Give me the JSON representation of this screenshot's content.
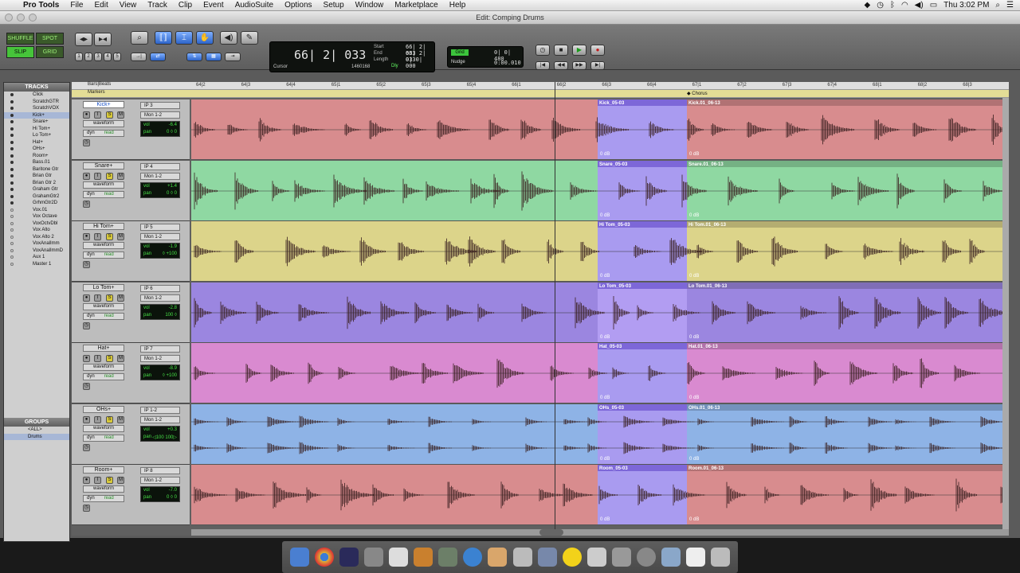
{
  "menubar": {
    "items": [
      "Pro Tools",
      "File",
      "Edit",
      "View",
      "Track",
      "Clip",
      "Event",
      "AudioSuite",
      "Options",
      "Setup",
      "Window",
      "Marketplace",
      "Help"
    ],
    "clock": "Thu 3:02 PM"
  },
  "window": {
    "title": "Edit: Comping Drums"
  },
  "toolbar": {
    "modes": [
      "SHUFFLE",
      "SPOT",
      "SLIP",
      "GRID"
    ],
    "edit_mode_active": "SLIP",
    "zoom_presets": [
      "1",
      "2",
      "3",
      "4",
      "5"
    ],
    "counter_main": "66| 2| 033",
    "start_label": "Start",
    "start_value": "66| 2| 033",
    "end_label": "End",
    "end_value": "66| 2| 033",
    "length_label": "Length",
    "length_value": "0| 0| 000",
    "cursor_label": "Cursor",
    "cursor_value": "1460168",
    "dly_label": "Dly",
    "grid_label": "Grid",
    "grid_value": "0| 0| 480",
    "nudge_label": "Nudge",
    "nudge_value": "0:00.010"
  },
  "tracks_panel": {
    "title": "TRACKS",
    "items": [
      "Click",
      "ScratchGTR",
      "ScratchVOX",
      "Kick+",
      "Snare+",
      "Hi Tom+",
      "Lo Tom+",
      "Hat+",
      "OHs+",
      "Room+",
      "Bass.01",
      "Baritone Gtr",
      "Brian Gtr",
      "Brian Gtr 2",
      "Graham Gtr",
      "GrahamGtr2",
      "GrhmGtr2D",
      "Vox.01",
      "Vox Octave",
      "VoxOctvDbl",
      "Vox Alto",
      "Vox Alto 2",
      "VoxAnalImm",
      "VoxAnalImmD",
      "Aux 1",
      "Master 1"
    ],
    "selected": "Kick+",
    "groups_title": "GROUPS",
    "groups": [
      "<ALL>",
      "Drums"
    ]
  },
  "ruler": {
    "bars_label": "Bars|Beats",
    "markers_label": "Markers",
    "ticks": [
      "64|2",
      "64|3",
      "64|4",
      "65|1",
      "65|2",
      "65|3",
      "65|4",
      "66|1",
      "66|2",
      "66|3",
      "66|4",
      "67|1",
      "67|2",
      "67|3",
      "67|4",
      "68|1",
      "68|2",
      "68|3"
    ],
    "marker_name": "Chorus"
  },
  "tracks": [
    {
      "name": "Kick+",
      "input": "IP 3",
      "output": "Mon 1-2",
      "view": "waveform",
      "dyn": "dyn",
      "read": "read",
      "vol": "-6.4",
      "pan": "0 ◊ 0",
      "clips": [
        "Kick_05-03",
        "Kick.01_06-13"
      ],
      "gain": "0 dB",
      "color": "#d88c8e",
      "comp_color": "#a99bf0"
    },
    {
      "name": "Snare+",
      "input": "IP 4",
      "output": "Mon 1-2",
      "view": "waveform",
      "dyn": "dyn",
      "read": "read",
      "vol": "+1.4",
      "pan": "0 ◊ 0",
      "clips": [
        "Snare_05-03",
        "Snare.01_06-13"
      ],
      "gain": "0 dB",
      "color": "#8fd8a2",
      "comp_color": "#a99bf0"
    },
    {
      "name": "Hi Tom+",
      "input": "IP 5",
      "output": "Mon 1-2",
      "view": "waveform",
      "dyn": "dyn",
      "read": "read",
      "vol": "-1.9",
      "pan": "◊ +100",
      "clips": [
        "Hi Tom_05-03",
        "Hi Tom.01_06-13"
      ],
      "gain": "0 dB",
      "color": "#dcd48a",
      "comp_color": "#a99bf0"
    },
    {
      "name": "Lo Tom+",
      "input": "IP 6",
      "output": "Mon 1-2",
      "view": "waveform",
      "dyn": "dyn",
      "read": "read",
      "vol": "-2.8",
      "pan": "100 ◊",
      "clips": [
        "Lo Tom_05-03",
        "Lo Tom.01_06-13"
      ],
      "gain": "0 dB",
      "color": "#9b86e0",
      "comp_color": "#b29df2"
    },
    {
      "name": "Hat+",
      "input": "IP 7",
      "output": "Mon 1-2",
      "view": "waveform",
      "dyn": "dyn",
      "read": "read",
      "vol": "-8.9",
      "pan": "◊ +100",
      "clips": [
        "Hat_05-03",
        "Hat.01_06-13"
      ],
      "gain": "0 dB",
      "color": "#d98ad0",
      "comp_color": "#a99bf0"
    },
    {
      "name": "OHs+",
      "input": "IP 1-2",
      "output": "Mon 1-2",
      "view": "waveform",
      "dyn": "dyn",
      "read": "read",
      "vol": "+0.3",
      "pan": "◁100 100▷",
      "clips": [
        "OHs_05-03",
        "OHs.01_06-13"
      ],
      "gain": "0 dB",
      "color": "#8eb3e6",
      "comp_color": "#a99bf0"
    },
    {
      "name": "Room+",
      "input": "IP 8",
      "output": "Mon 1-2",
      "view": "waveform",
      "dyn": "dyn",
      "read": "read",
      "vol": "-7.0",
      "pan": "0 ◊ 0",
      "clips": [
        "Room_05-03",
        "Room.01_06-13"
      ],
      "gain": "0 dB",
      "color": "#d88c8e",
      "comp_color": "#a99bf0"
    }
  ]
}
